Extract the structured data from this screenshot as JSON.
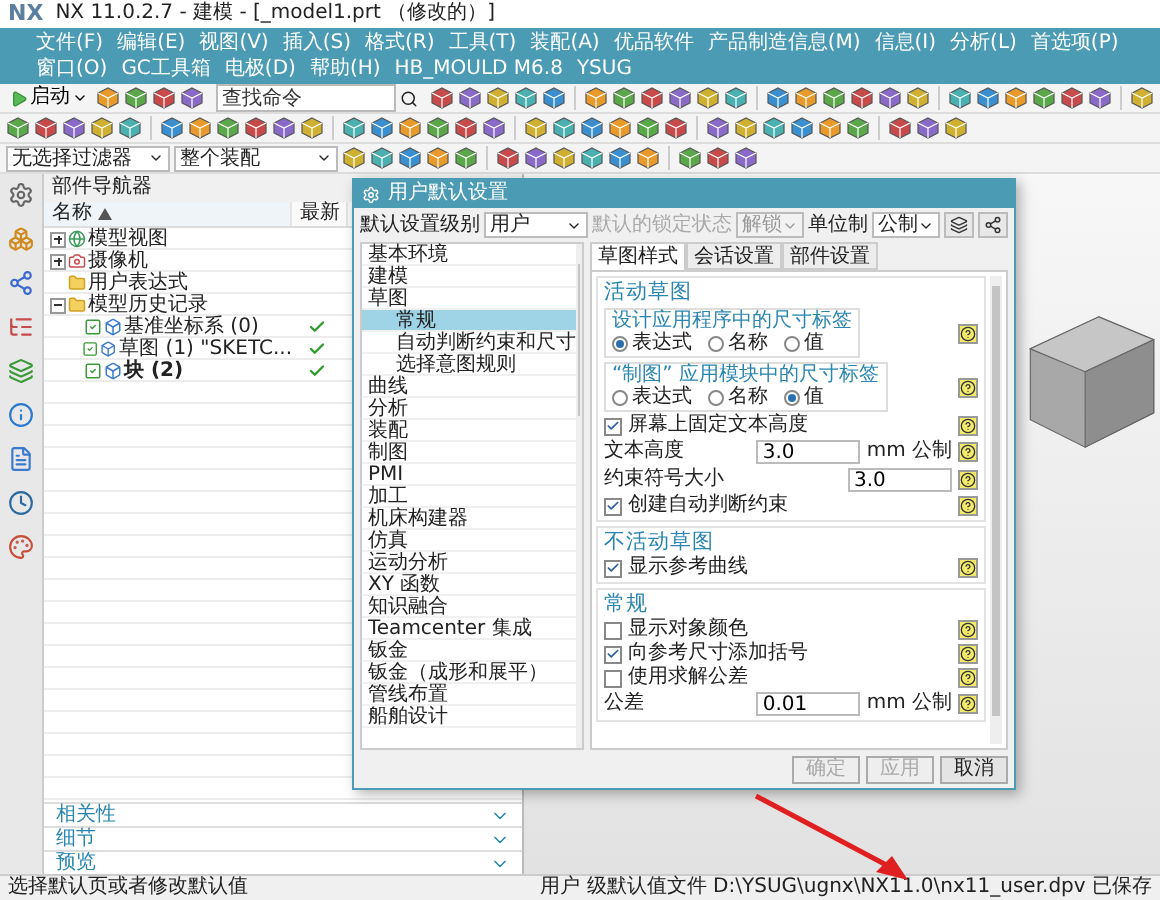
{
  "window": {
    "logo": "NX",
    "title": "NX 11.0.2.7 - 建模 - [_model1.prt （修改的）]"
  },
  "menu_bar": [
    "文件(F)",
    "编辑(E)",
    "视图(V)",
    "插入(S)",
    "格式(R)",
    "工具(T)",
    "装配(A)",
    "优品软件",
    "产品制造信息(M)",
    "信息(I)",
    "分析(L)",
    "首选项(P)",
    "窗口(O)",
    "GC工具箱",
    "电极(D)",
    "帮助(H)",
    "HB_MOULD M6.8",
    "YSUG"
  ],
  "toolbar": {
    "start_button": "启动",
    "search": {
      "placeholder": "查找命令"
    },
    "selection_filter": "无选择过滤器",
    "assembly_scope": "整个装配"
  },
  "part_navigator": {
    "title": "部件导航器",
    "columns": [
      {
        "label": "名称",
        "sorted": true
      },
      {
        "label": "最新",
        "sorted": false
      }
    ],
    "tree": [
      {
        "kind": "view",
        "label": "模型视图",
        "expanded": false
      },
      {
        "kind": "camera",
        "label": "摄像机",
        "expanded": false
      },
      {
        "kind": "folder",
        "label": "用户表达式"
      },
      {
        "kind": "folder",
        "label": "模型历史记录",
        "expanded": true,
        "children": [
          {
            "kind": "feature",
            "label": "基准坐标系 (0)",
            "up_to_date": true,
            "current": false
          },
          {
            "kind": "feature",
            "label": "草图 (1) \"SKETC...",
            "up_to_date": true,
            "current": false
          },
          {
            "kind": "feature",
            "label": "块 (2)",
            "up_to_date": true,
            "current": true
          }
        ]
      }
    ],
    "sections": [
      {
        "label": "相关性",
        "expanded": false
      },
      {
        "label": "细节",
        "expanded": false
      },
      {
        "label": "预览",
        "expanded": false
      }
    ]
  },
  "dialog": {
    "title": "用户默认设置",
    "settings_level": {
      "label": "默认设置级别",
      "value": "用户"
    },
    "lock_state": {
      "label": "默认的锁定状态",
      "value": "解锁",
      "disabled": true
    },
    "units": {
      "label": "单位制",
      "value": "公制"
    },
    "categories": [
      {
        "label": "基本环境",
        "selected": false
      },
      {
        "label": "建模",
        "selected": false
      },
      {
        "label": "草图",
        "selected": false,
        "children": [
          {
            "label": "常规",
            "selected": true
          },
          {
            "label": "自动判断约束和尺寸",
            "selected": false
          },
          {
            "label": "选择意图规则",
            "selected": false
          }
        ]
      },
      {
        "label": "曲线",
        "selected": false
      },
      {
        "label": "分析",
        "selected": false
      },
      {
        "label": "装配",
        "selected": false
      },
      {
        "label": "制图",
        "selected": false
      },
      {
        "label": "PMI",
        "selected": false
      },
      {
        "label": "加工",
        "selected": false
      },
      {
        "label": "机床构建器",
        "selected": false
      },
      {
        "label": "仿真",
        "selected": false
      },
      {
        "label": "运动分析",
        "selected": false
      },
      {
        "label": "XY 函数",
        "selected": false
      },
      {
        "label": "知识融合",
        "selected": false
      },
      {
        "label": "Teamcenter 集成",
        "selected": false
      },
      {
        "label": "钣金",
        "selected": false
      },
      {
        "label": "钣金（成形和展平）",
        "selected": false
      },
      {
        "label": "管线布置",
        "selected": false
      },
      {
        "label": "船舶设计",
        "selected": false
      }
    ],
    "tabs": [
      {
        "label": "草图样式",
        "selected": true
      },
      {
        "label": "会话设置",
        "selected": false
      },
      {
        "label": "部件设置",
        "selected": false
      }
    ],
    "groups": [
      {
        "title": "活动草图",
        "rows": [
          {
            "kind": "radio_group",
            "title": "设计应用程序中的尺寸标签",
            "options": [
              {
                "label": "表达式",
                "selected": true
              },
              {
                "label": "名称",
                "selected": false
              },
              {
                "label": "值",
                "selected": false
              }
            ]
          },
          {
            "kind": "radio_group",
            "title": "“制图” 应用模块中的尺寸标签",
            "options": [
              {
                "label": "表达式",
                "selected": false
              },
              {
                "label": "名称",
                "selected": false
              },
              {
                "label": "值",
                "selected": true
              }
            ]
          },
          {
            "kind": "checkbox",
            "label": "屏幕上固定文本高度",
            "checked": true
          },
          {
            "kind": "number",
            "label": "文本高度",
            "value": "3.0",
            "unit": "mm 公制"
          },
          {
            "kind": "number",
            "label": "约束符号大小",
            "value": "3.0"
          },
          {
            "kind": "checkbox",
            "label": "创建自动判断约束",
            "checked": true
          }
        ]
      },
      {
        "title": "不活动草图",
        "rows": [
          {
            "kind": "checkbox",
            "label": "显示参考曲线",
            "checked": true
          }
        ]
      },
      {
        "title": "常规",
        "rows": [
          {
            "kind": "checkbox",
            "label": "显示对象颜色",
            "checked": false
          },
          {
            "kind": "checkbox",
            "label": "向参考尺寸添加括号",
            "checked": true
          },
          {
            "kind": "checkbox",
            "label": "使用求解公差",
            "checked": false
          },
          {
            "kind": "number",
            "label": "公差",
            "value": "0.01",
            "unit": "mm 公制"
          }
        ]
      }
    ],
    "buttons": [
      {
        "label": "确定",
        "disabled": true
      },
      {
        "label": "应用",
        "disabled": true
      },
      {
        "label": "取消",
        "disabled": false
      }
    ]
  },
  "status_bar": {
    "message": "选择默认页或者修改默认值",
    "file_status": "用户 级默认值文件 D:\\YSUG\\ugnx\\NX11.0\\nx11_user.dpv 已保存"
  }
}
